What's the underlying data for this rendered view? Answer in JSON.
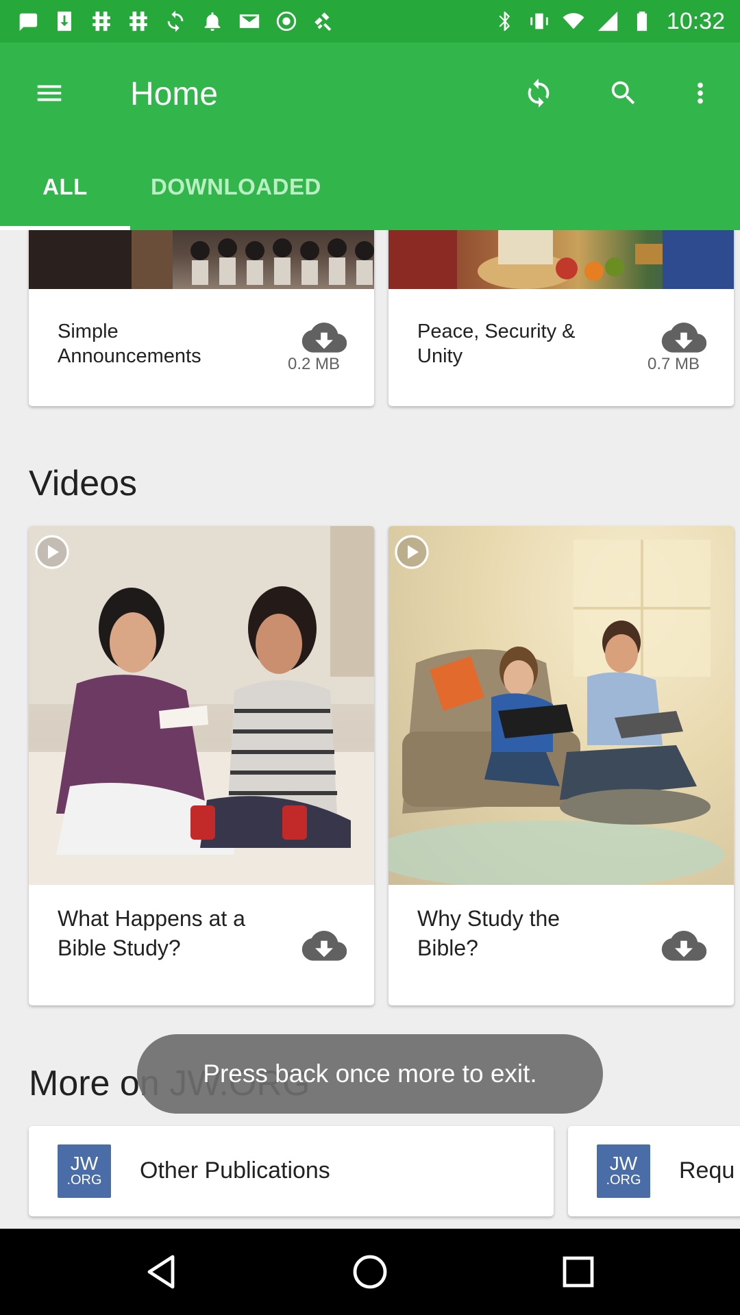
{
  "status_bar": {
    "time": "10:32",
    "left_icons": [
      "messages-icon",
      "download-icon",
      "grid-icon",
      "grid-icon",
      "sync-icon",
      "notification-icon",
      "email-icon",
      "circle-icon",
      "satellite-fake-gps-icon"
    ],
    "right_icons": [
      "bluetooth-icon",
      "vibrate-icon",
      "wifi-icon",
      "signal-icon",
      "battery-icon"
    ]
  },
  "app_bar": {
    "title": "Home",
    "color": "#32b54a",
    "tabs": [
      {
        "label": "ALL",
        "selected": true
      },
      {
        "label": "DOWNLOADED",
        "selected": false
      }
    ]
  },
  "top_cards": [
    {
      "title": "Simple Announcements",
      "size": "0.2 MB"
    },
    {
      "title": "Peace, Security & Unity",
      "size": "0.7 MB"
    }
  ],
  "videos": {
    "heading": "Videos",
    "items": [
      {
        "title": "What Happens at a Bible Study?"
      },
      {
        "title": "Why Study the Bible?"
      }
    ]
  },
  "more": {
    "heading": "More on JW.ORG",
    "logo_line1": "JW",
    "logo_line2": ".ORG",
    "items": [
      {
        "label": "Other Publications"
      },
      {
        "label": "Requ"
      }
    ]
  },
  "toast": {
    "text": "Press back once more to exit."
  }
}
